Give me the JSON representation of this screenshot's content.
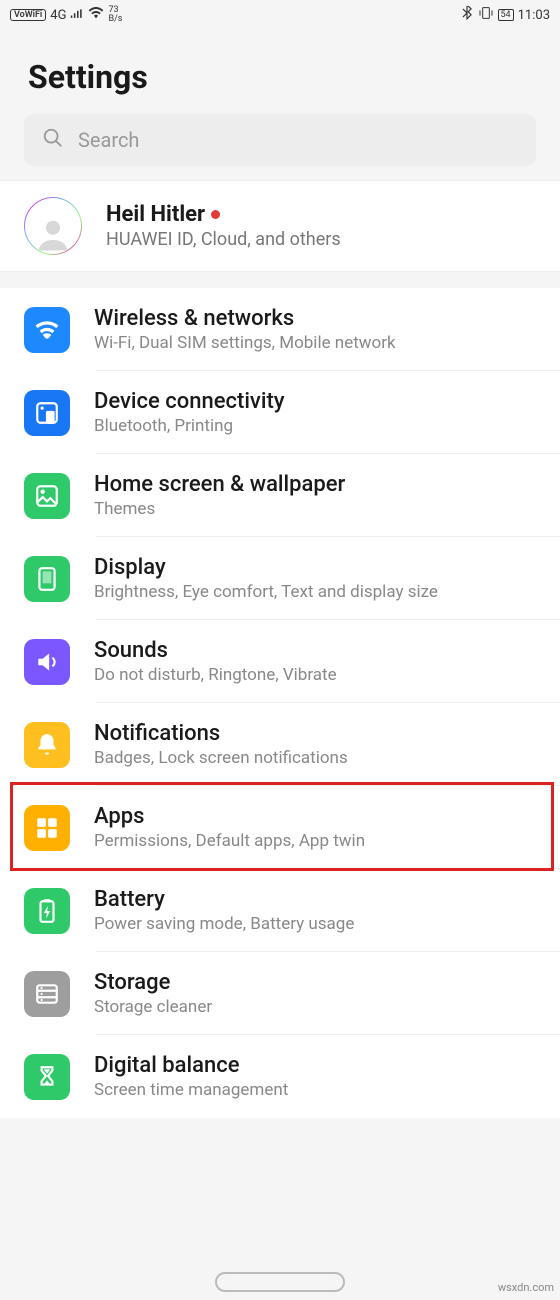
{
  "status": {
    "vowifi": "VoWiFi",
    "net": "4G",
    "speed_top": "73",
    "speed_bot": "B/s",
    "battery": "54",
    "time": "11:03"
  },
  "header": {
    "title": "Settings"
  },
  "search": {
    "placeholder": "Search"
  },
  "account": {
    "name": "Heil Hitler",
    "desc": "HUAWEI ID, Cloud, and others"
  },
  "items": [
    {
      "icon": "wifi-icon",
      "color": "c-blue",
      "title": "Wireless & networks",
      "sub": "Wi-Fi, Dual SIM settings, Mobile network"
    },
    {
      "icon": "devices-icon",
      "color": "c-blue2",
      "title": "Device connectivity",
      "sub": "Bluetooth, Printing"
    },
    {
      "icon": "wallpaper-icon",
      "color": "c-green",
      "title": "Home screen & wallpaper",
      "sub": "Themes"
    },
    {
      "icon": "display-icon",
      "color": "c-green",
      "title": "Display",
      "sub": "Brightness, Eye comfort, Text and display size"
    },
    {
      "icon": "sound-icon",
      "color": "c-purple",
      "title": "Sounds",
      "sub": "Do not disturb, Ringtone, Vibrate"
    },
    {
      "icon": "bell-icon",
      "color": "c-yellow",
      "title": "Notifications",
      "sub": "Badges, Lock screen notifications"
    },
    {
      "icon": "apps-icon",
      "color": "c-orange",
      "title": "Apps",
      "sub": "Permissions, Default apps, App twin",
      "highlight": true
    },
    {
      "icon": "battery-icon",
      "color": "c-green2",
      "title": "Battery",
      "sub": "Power saving mode, Battery usage"
    },
    {
      "icon": "storage-icon",
      "color": "c-grey",
      "title": "Storage",
      "sub": "Storage cleaner"
    },
    {
      "icon": "hourglass-icon",
      "color": "c-green",
      "title": "Digital balance",
      "sub": "Screen time management"
    }
  ],
  "watermark": "wsxdn.com"
}
